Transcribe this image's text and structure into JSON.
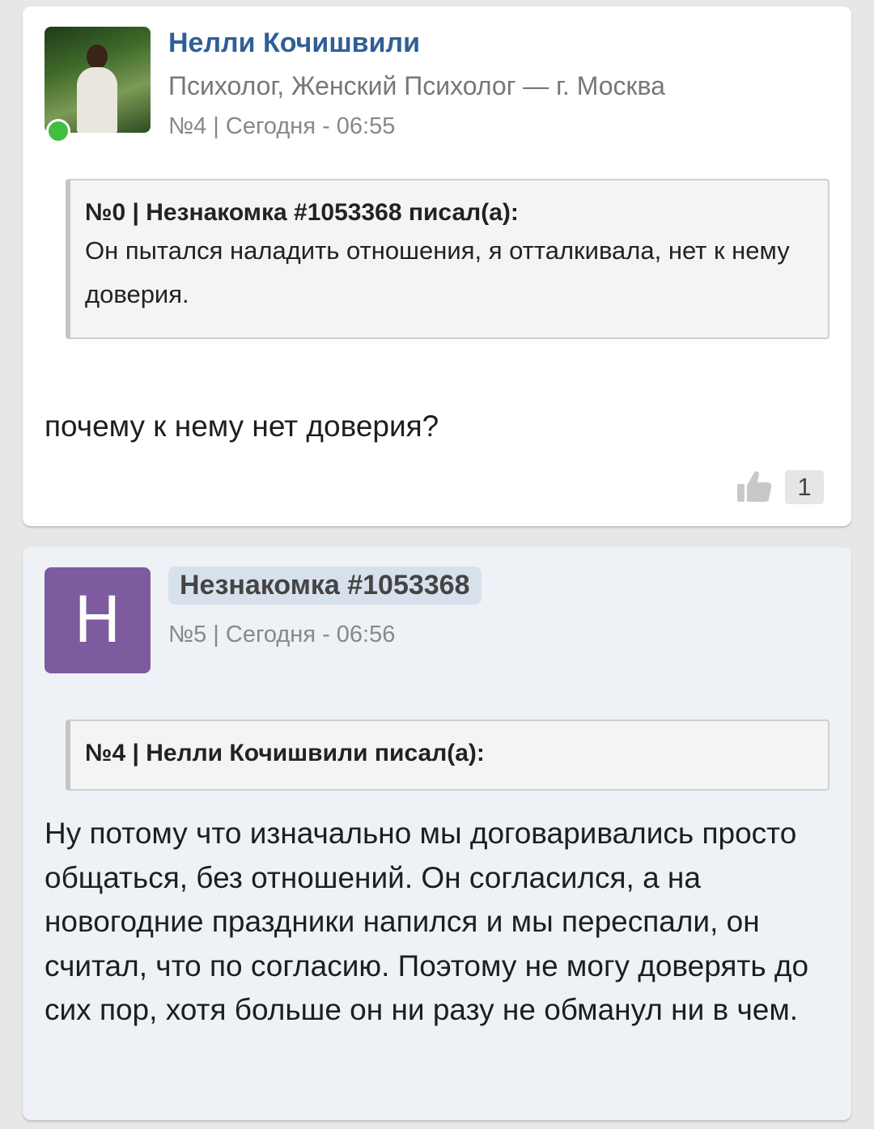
{
  "posts": [
    {
      "author": "Нелли Кочишвили",
      "role": "Психолог, Женский Психолог — г. Москва",
      "meta": "№4 | Сегодня - 06:55",
      "avatar_icon": "user-photo",
      "online": true,
      "quote": {
        "header": "№0 | Незнакомка #1053368 писал(а):",
        "text": "Он пытался наладить отношения, я отталкивала, нет к нему доверия."
      },
      "body": "почему к нему нет доверия?",
      "like_icon": "thumbs-up-icon",
      "likes": "1"
    },
    {
      "author": "Незнакомка #1053368",
      "avatar_letter": "Н",
      "avatar_color": "#7e5a9e",
      "meta": "№5 | Сегодня - 06:56",
      "quote": {
        "header": "№4 | Нелли Кочишвили писал(а):"
      },
      "body": "Ну потому что изначально мы договаривались просто общаться, без отношений. Он согласился, а на новогодние праздники напился и мы переспали, он считал, что по согласию. Поэтому не могу доверять до сих пор, хотя больше он ни разу не обманул ни в чем."
    }
  ],
  "colors": {
    "page_background": "#e7e7e7",
    "author_link": "#2f5f96",
    "online_indicator": "#3fbf3f",
    "anon_badge_bg": "#d7e1ec"
  }
}
